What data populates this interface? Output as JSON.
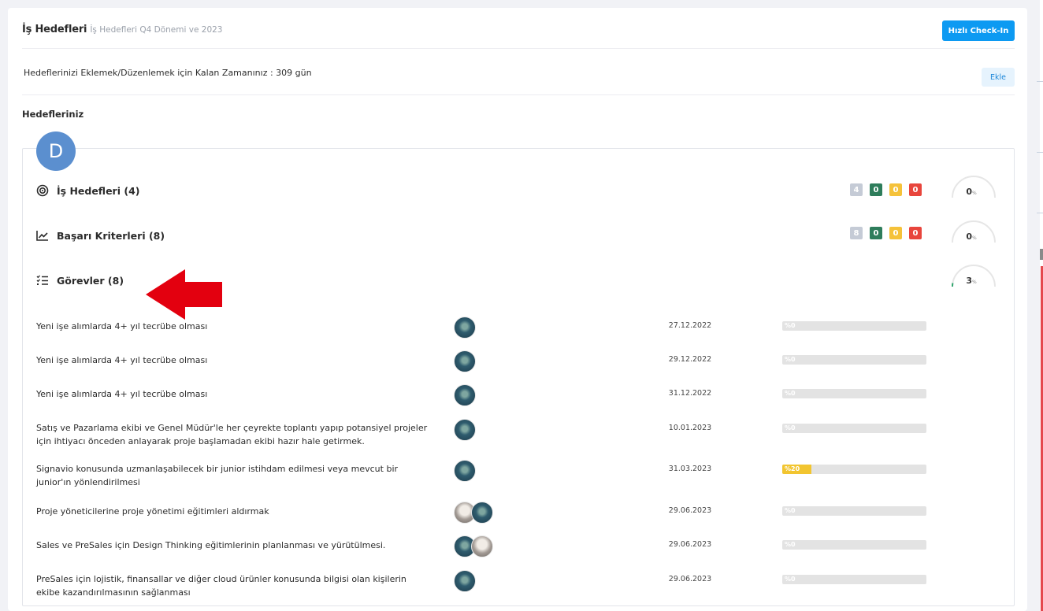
{
  "header": {
    "title": "İş Hedefleri",
    "subtitle": "İş Hedefleri Q4 Dönemi ve 2023",
    "checkin_label": "Hızlı Check-In"
  },
  "remaining": {
    "text": "Hedeflerinizi Eklemek/Düzenlemek için Kalan Zamanınız : 309 gün",
    "add_label": "Ekle"
  },
  "section_title": "Hedefleriniz",
  "user_initial": "D",
  "groups": [
    {
      "label": "İş Hedefleri (4)",
      "icon": "target-icon",
      "counts": [
        "4",
        "0",
        "0",
        "0"
      ],
      "progress": "0",
      "unit": "%"
    },
    {
      "label": "Başarı Kriterleri (8)",
      "icon": "trend-chart-icon",
      "counts": [
        "8",
        "0",
        "0",
        "0"
      ],
      "progress": "0",
      "unit": "%"
    },
    {
      "label": "Görevler (8)",
      "icon": "checklist-icon",
      "progress": "3",
      "unit": "%"
    }
  ],
  "badge_colors": {
    "total": "#c5cbd6",
    "done": "#2e7d5b",
    "warn": "#f5c23a",
    "late": "#e8453c"
  },
  "tasks": [
    {
      "name": "Yeni işe alımlarda 4+ yıl tecrübe olması",
      "date": "27.12.2022",
      "progress": 0,
      "progress_label": "%0"
    },
    {
      "name": "Yeni işe alımlarda 4+ yıl tecrübe olması",
      "date": "29.12.2022",
      "progress": 0,
      "progress_label": "%0"
    },
    {
      "name": "Yeni işe alımlarda 4+ yıl tecrübe olması",
      "date": "31.12.2022",
      "progress": 0,
      "progress_label": "%0"
    },
    {
      "name": "Satış ve Pazarlama ekibi ve Genel Müdür'le her çeyrekte toplantı yapıp potansiyel projeler için ihtiyacı önceden anlayarak proje başlamadan ekibi hazır hale getirmek.",
      "date": "10.01.2023",
      "progress": 0,
      "progress_label": "%0"
    },
    {
      "name": "Signavio konusunda uzmanlaşabilecek bir junior istihdam edilmesi veya mevcut bir junior'ın yönlendirilmesi",
      "date": "31.03.2023",
      "progress": 20,
      "progress_label": "%20"
    },
    {
      "name": "Proje yöneticilerine proje yönetimi eğitimleri aldırmak",
      "date": "29.06.2023",
      "progress": 0,
      "progress_label": "%0"
    },
    {
      "name": "Sales ve PreSales için Design Thinking eğitimlerinin planlanması ve yürütülmesi.",
      "date": "29.06.2023",
      "progress": 0,
      "progress_label": "%0"
    },
    {
      "name": "PreSales için lojistik, finansallar ve diğer cloud ürünler konusunda bilgisi olan kişilerin ekibe kazandırılmasının sağlanması",
      "date": "29.06.2023",
      "progress": 0,
      "progress_label": "%0"
    }
  ]
}
